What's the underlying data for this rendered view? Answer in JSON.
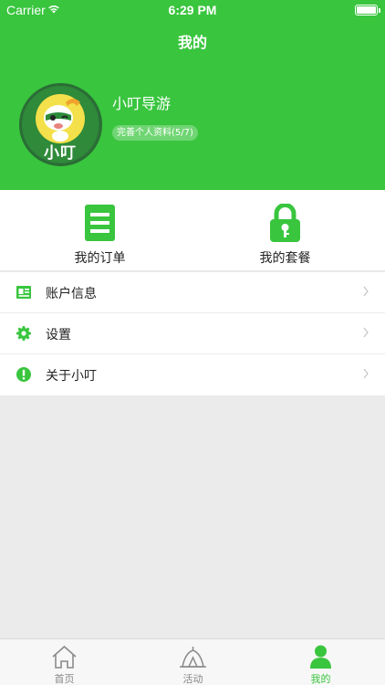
{
  "status_bar": {
    "carrier": "Carrier",
    "time": "6:29 PM"
  },
  "nav": {
    "title": "我的"
  },
  "profile": {
    "name": "小叮导游",
    "completion": "完善个人资料(5/7)",
    "avatar_text": "小叮"
  },
  "quick_actions": [
    {
      "label": "我的订单",
      "icon": "order-list-icon"
    },
    {
      "label": "我的套餐",
      "icon": "lock-icon"
    }
  ],
  "menu": [
    {
      "label": "账户信息",
      "icon": "id-card-icon"
    },
    {
      "label": "设置",
      "icon": "gear-icon"
    },
    {
      "label": "关于小叮",
      "icon": "info-alert-icon"
    }
  ],
  "tabs": [
    {
      "label": "首页",
      "icon": "home-icon",
      "active": false
    },
    {
      "label": "活动",
      "icon": "tent-icon",
      "active": false
    },
    {
      "label": "我的",
      "icon": "user-icon",
      "active": true
    }
  ],
  "colors": {
    "brand": "#39c53e",
    "tab_inactive": "#888888",
    "background": "#ebebeb"
  }
}
